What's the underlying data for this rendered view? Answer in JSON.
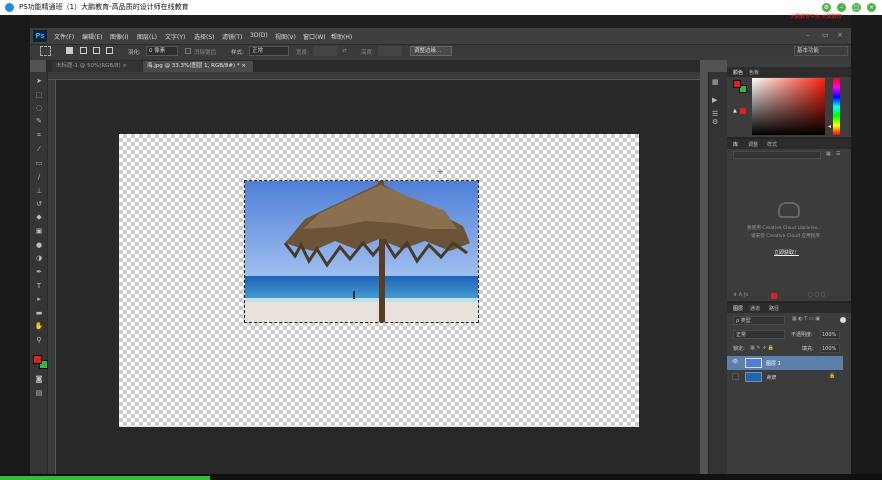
{
  "window": {
    "title": "PS功能精通班（1）大鹏教育-高品质的设计师在线教育",
    "badge": "大鹏教育平台·大鹏教育"
  },
  "app": {
    "logo": "Ps",
    "menu": [
      "文件(F)",
      "编辑(E)",
      "图像(I)",
      "图层(L)",
      "文字(Y)",
      "选择(S)",
      "滤镜(T)",
      "3D(D)",
      "视图(V)",
      "窗口(W)",
      "帮助(H)"
    ]
  },
  "options": {
    "feather_label": "羽化:",
    "feather_value": "0 像素",
    "antialias_label": "消除锯齿",
    "style_label": "样式:",
    "style_value": "正常",
    "width_label": "宽度:",
    "height_label": "高度:",
    "refine_button": "调整边缘...",
    "workspace": "基本功能"
  },
  "tabs": [
    {
      "label": "未标题-1 @ 50%(RGB/8) ×",
      "active": false
    },
    {
      "label": "海.jpg @ 33.3%(图层 1, RGB/8#) * ×",
      "active": true
    }
  ],
  "panels": {
    "color_tabs": [
      "颜色",
      "色板"
    ],
    "library_tabs": [
      "库",
      "调整",
      "样式"
    ],
    "cc_text_1": "要使用 Creative Cloud Libraries,",
    "cc_text_2": "请安装 Creative Cloud 应用程序",
    "cc_link": "立即获取！",
    "layer_tabs": [
      "图层",
      "通道",
      "路径"
    ],
    "kind_label": "ρ 类型",
    "blend_mode": "正常",
    "opacity_label": "不透明度:",
    "opacity_value": "100%",
    "lock_label": "锁定:",
    "fill_label": "填充:",
    "fill_value": "100%",
    "layers": [
      {
        "name": "图层 1",
        "selected": true
      },
      {
        "name": "背景",
        "selected": false
      }
    ]
  },
  "colors": {
    "foreground": "#e0201a",
    "background": "#2bbf3a",
    "accent": "#31a8ff"
  }
}
